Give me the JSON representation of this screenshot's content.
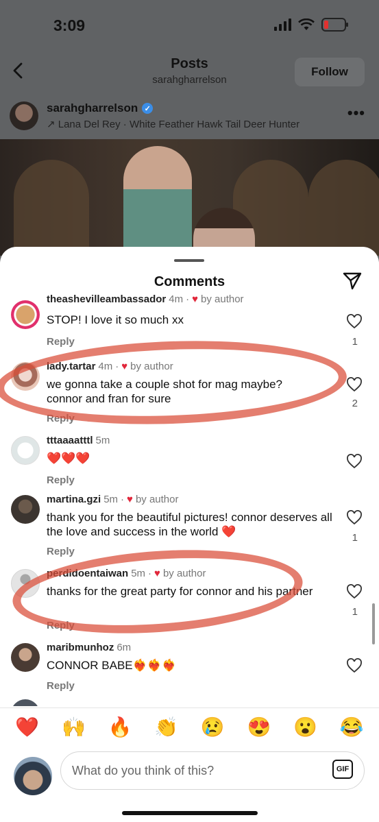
{
  "status": {
    "time": "3:09"
  },
  "nav": {
    "title": "Posts",
    "subtitle": "sarahgharrelson",
    "follow_label": "Follow"
  },
  "post": {
    "username": "sarahgharrelson",
    "music": "↗ Lana Del Rey · White Feather Hawk Tail Deer Hunter"
  },
  "sheet": {
    "title": "Comments"
  },
  "comments": [
    {
      "user": "theashevilleambassador",
      "time": "4m",
      "liked_by_author": true,
      "author_label": "by author",
      "text": "STOP! I love it so much xx",
      "reply": "Reply",
      "likes": "1"
    },
    {
      "user": "lady.tartar",
      "time": "4m",
      "liked_by_author": true,
      "author_label": "by author",
      "text": "we gonna take a couple shot for mag maybe? connor and fran for sure",
      "reply": "Reply",
      "likes": "2"
    },
    {
      "user": "tttaaaatttl",
      "time": "5m",
      "liked_by_author": false,
      "author_label": "",
      "text": "❤️❤️❤️",
      "reply": "Reply",
      "likes": ""
    },
    {
      "user": "martina.gzi",
      "time": "5m",
      "liked_by_author": true,
      "author_label": "by author",
      "text": "thank you for the beautiful pictures! connor deserves all the love and success in the world ❤️",
      "reply": "Reply",
      "likes": "1"
    },
    {
      "user": "perdidoentaiwan",
      "time": "5m",
      "liked_by_author": true,
      "author_label": "by author",
      "text": "thanks for the great party for connor and his partner",
      "reply": "Reply",
      "likes": "1"
    },
    {
      "user": "maribmunhoz",
      "time": "6m",
      "liked_by_author": false,
      "author_label": "",
      "text": "CONNOR BABE❤️‍🔥❤️‍🔥❤️‍🔥",
      "reply": "Reply",
      "likes": ""
    }
  ],
  "reactions": [
    "❤️",
    "🙌",
    "🔥",
    "👏",
    "😢",
    "😍",
    "😮",
    "😂"
  ],
  "composer": {
    "placeholder": "What do you think of this?",
    "gif_label": "GIF"
  },
  "colors": {
    "annotation": "#d94c38",
    "heart": "#e1273b",
    "verified": "#3b8ee8"
  }
}
